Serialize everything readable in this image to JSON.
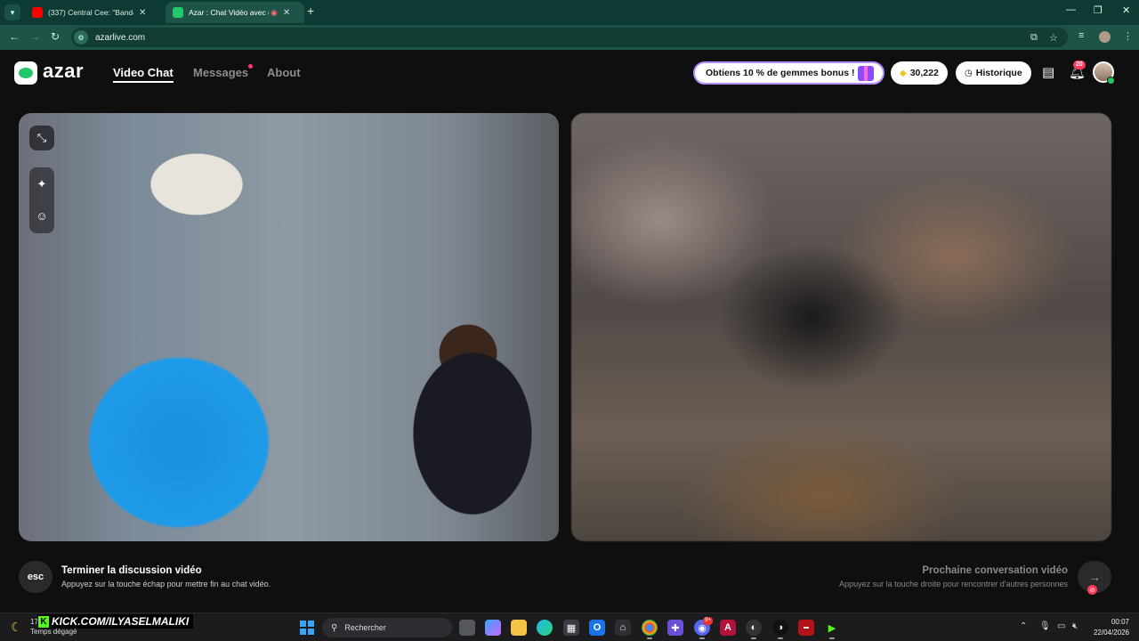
{
  "browser": {
    "tabs": [
      {
        "title": "(337) Central Cee: \"Band4Band\"",
        "favicon_color": "#ff0000",
        "active": false
      },
      {
        "title": "Azar : Chat Vidéo avec de n",
        "favicon_color": "#22c76a",
        "active": true
      }
    ],
    "url": "azarlive.com"
  },
  "azar": {
    "logo_text": "azar",
    "nav": {
      "video_chat": "Video Chat",
      "messages": "Messages",
      "about": "About"
    },
    "promo_label": "Obtiens 10 % de gemmes bonus !",
    "gems_count": "30,222",
    "history_label": "Historique",
    "notification_count": "20"
  },
  "actions": {
    "end": {
      "key": "esc",
      "title": "Terminer la discussion vidéo",
      "subtitle": "Appuyez sur la touche échap pour mettre fin au chat vidéo."
    },
    "next": {
      "title": "Prochaine conversation vidéo",
      "subtitle": "Appuyez sur la touche droite pour rencontrer d'autres personnes"
    }
  },
  "overlay": {
    "kick_text": "KICK.COM/ILYASELMALIKI"
  },
  "taskbar": {
    "weather_temp": "17",
    "weather_status": "Temps dégagé",
    "search_placeholder": "Rechercher",
    "discord_badge": "9+",
    "time": "00:07",
    "date": "22/04/2026"
  },
  "colors": {
    "brand_green": "#22c76a",
    "browser_frame": "#0d3b33",
    "notification_red": "#ff3b5c",
    "promo_border": "#b48cff"
  }
}
